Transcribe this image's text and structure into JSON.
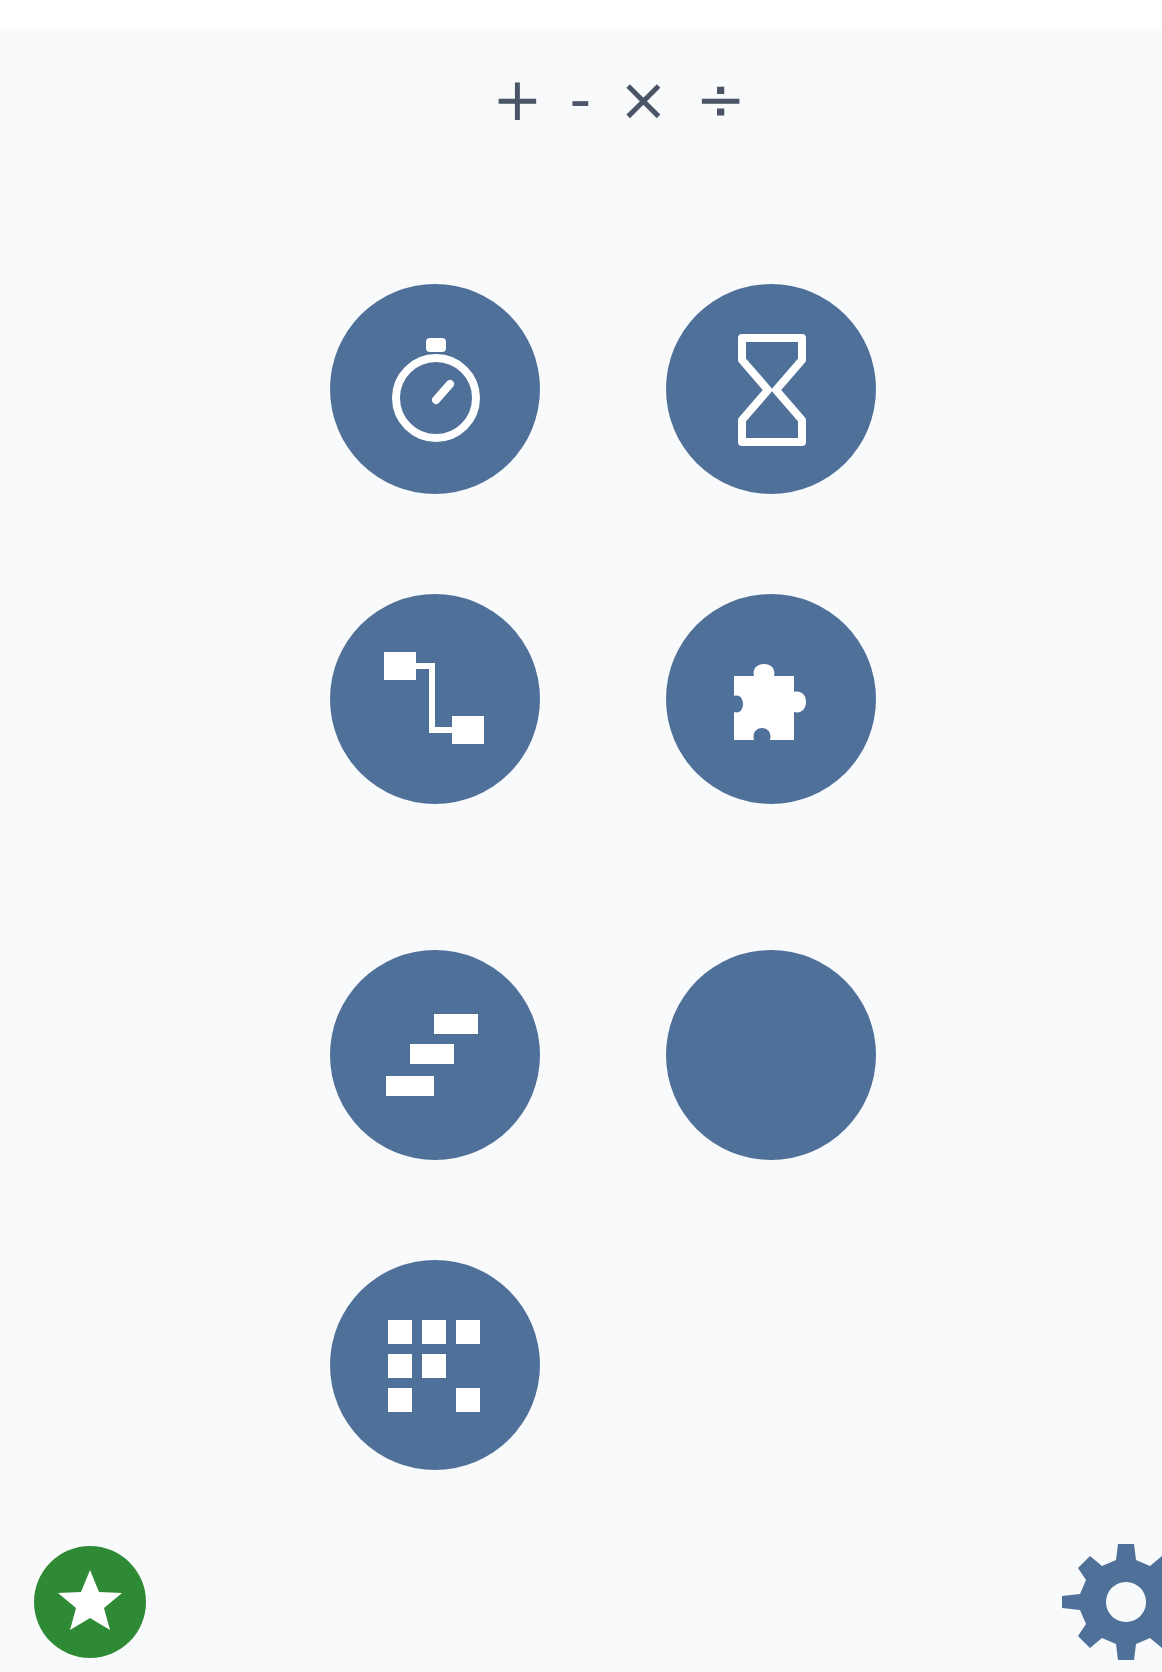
{
  "title": "+ - × ÷"
}
